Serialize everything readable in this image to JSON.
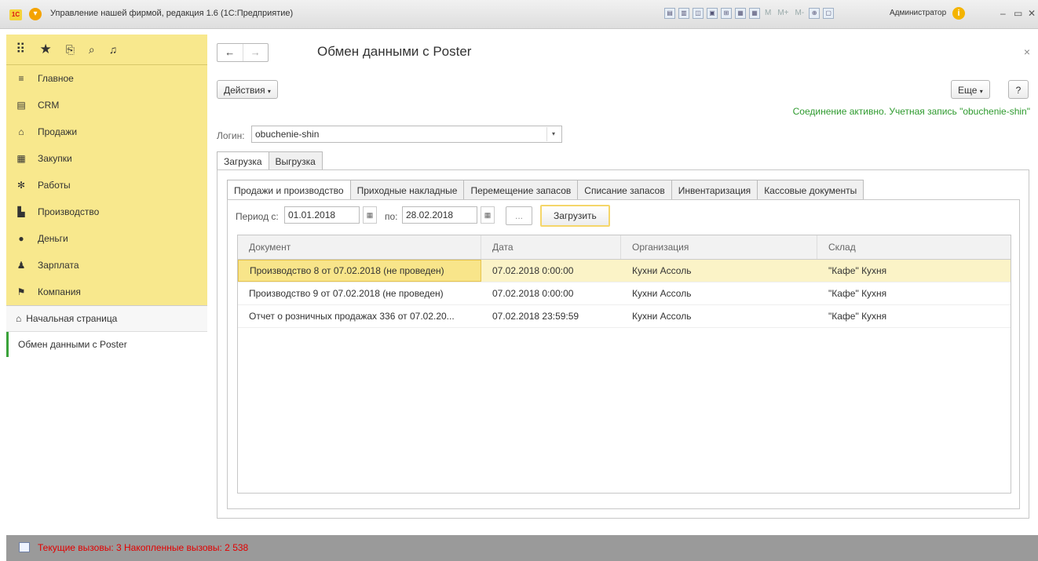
{
  "window": {
    "logo": "1С",
    "title": "Управление нашей фирмой, редакция 1.6  (1С:Предприятие)",
    "user": "Администратор"
  },
  "sidebar": {
    "menu": [
      {
        "label": "Главное",
        "icon": "≡"
      },
      {
        "label": "CRM",
        "icon": "▤"
      },
      {
        "label": "Продажи",
        "icon": "⌂"
      },
      {
        "label": "Закупки",
        "icon": "▦"
      },
      {
        "label": "Работы",
        "icon": "✻"
      },
      {
        "label": "Производство",
        "icon": "▙"
      },
      {
        "label": "Деньги",
        "icon": "●"
      },
      {
        "label": "Зарплата",
        "icon": "♟"
      },
      {
        "label": "Компания",
        "icon": "⚑"
      }
    ],
    "home": "Начальная страница",
    "open_form": "Обмен данными с Poster"
  },
  "form": {
    "title": "Обмен данными с Poster",
    "actions": "Действия",
    "more": "Еще",
    "help": "?",
    "connection_status": "Соединение активно. Учетная запись \"obuchenie-shin\"",
    "login_label": "Логин:",
    "login_value": "obuchenie-shin",
    "tabs": [
      "Загрузка",
      "Выгрузка"
    ],
    "subtabs": [
      "Продажи и производство",
      "Приходные накладные",
      "Перемещение запасов",
      "Списание запасов",
      "Инвентаризация",
      "Кассовые документы"
    ],
    "period_label": "Период с:",
    "date_from": "01.01.2018",
    "to_label": "по:",
    "date_to": "28.02.2018",
    "dots": "...",
    "load_button": "Загрузить",
    "table": {
      "headers": [
        "Документ",
        "Дата",
        "Организация",
        "Склад"
      ],
      "rows": [
        [
          "Производство 8 от 07.02.2018 (не проведен)",
          "07.02.2018 0:00:00",
          "Кухни Ассоль",
          "\"Кафе\" Кухня"
        ],
        [
          "Производство 9 от 07.02.2018 (не проведен)",
          "07.02.2018 0:00:00",
          "Кухни Ассоль",
          "\"Кафе\" Кухня"
        ],
        [
          "Отчет о розничных продажах 336 от 07.02.20...",
          "07.02.2018 23:59:59",
          "Кухни Ассоль",
          "\"Кафе\" Кухня"
        ]
      ]
    }
  },
  "statusbar": {
    "text": "Текущие вызовы: 3   Накопленные вызовы: 2 538"
  },
  "colors": {
    "sidebar_bg": "#f8e88d",
    "selected_row": "#fbf3c7",
    "status_ok": "#2e9a2e",
    "status_err": "#e30000"
  }
}
